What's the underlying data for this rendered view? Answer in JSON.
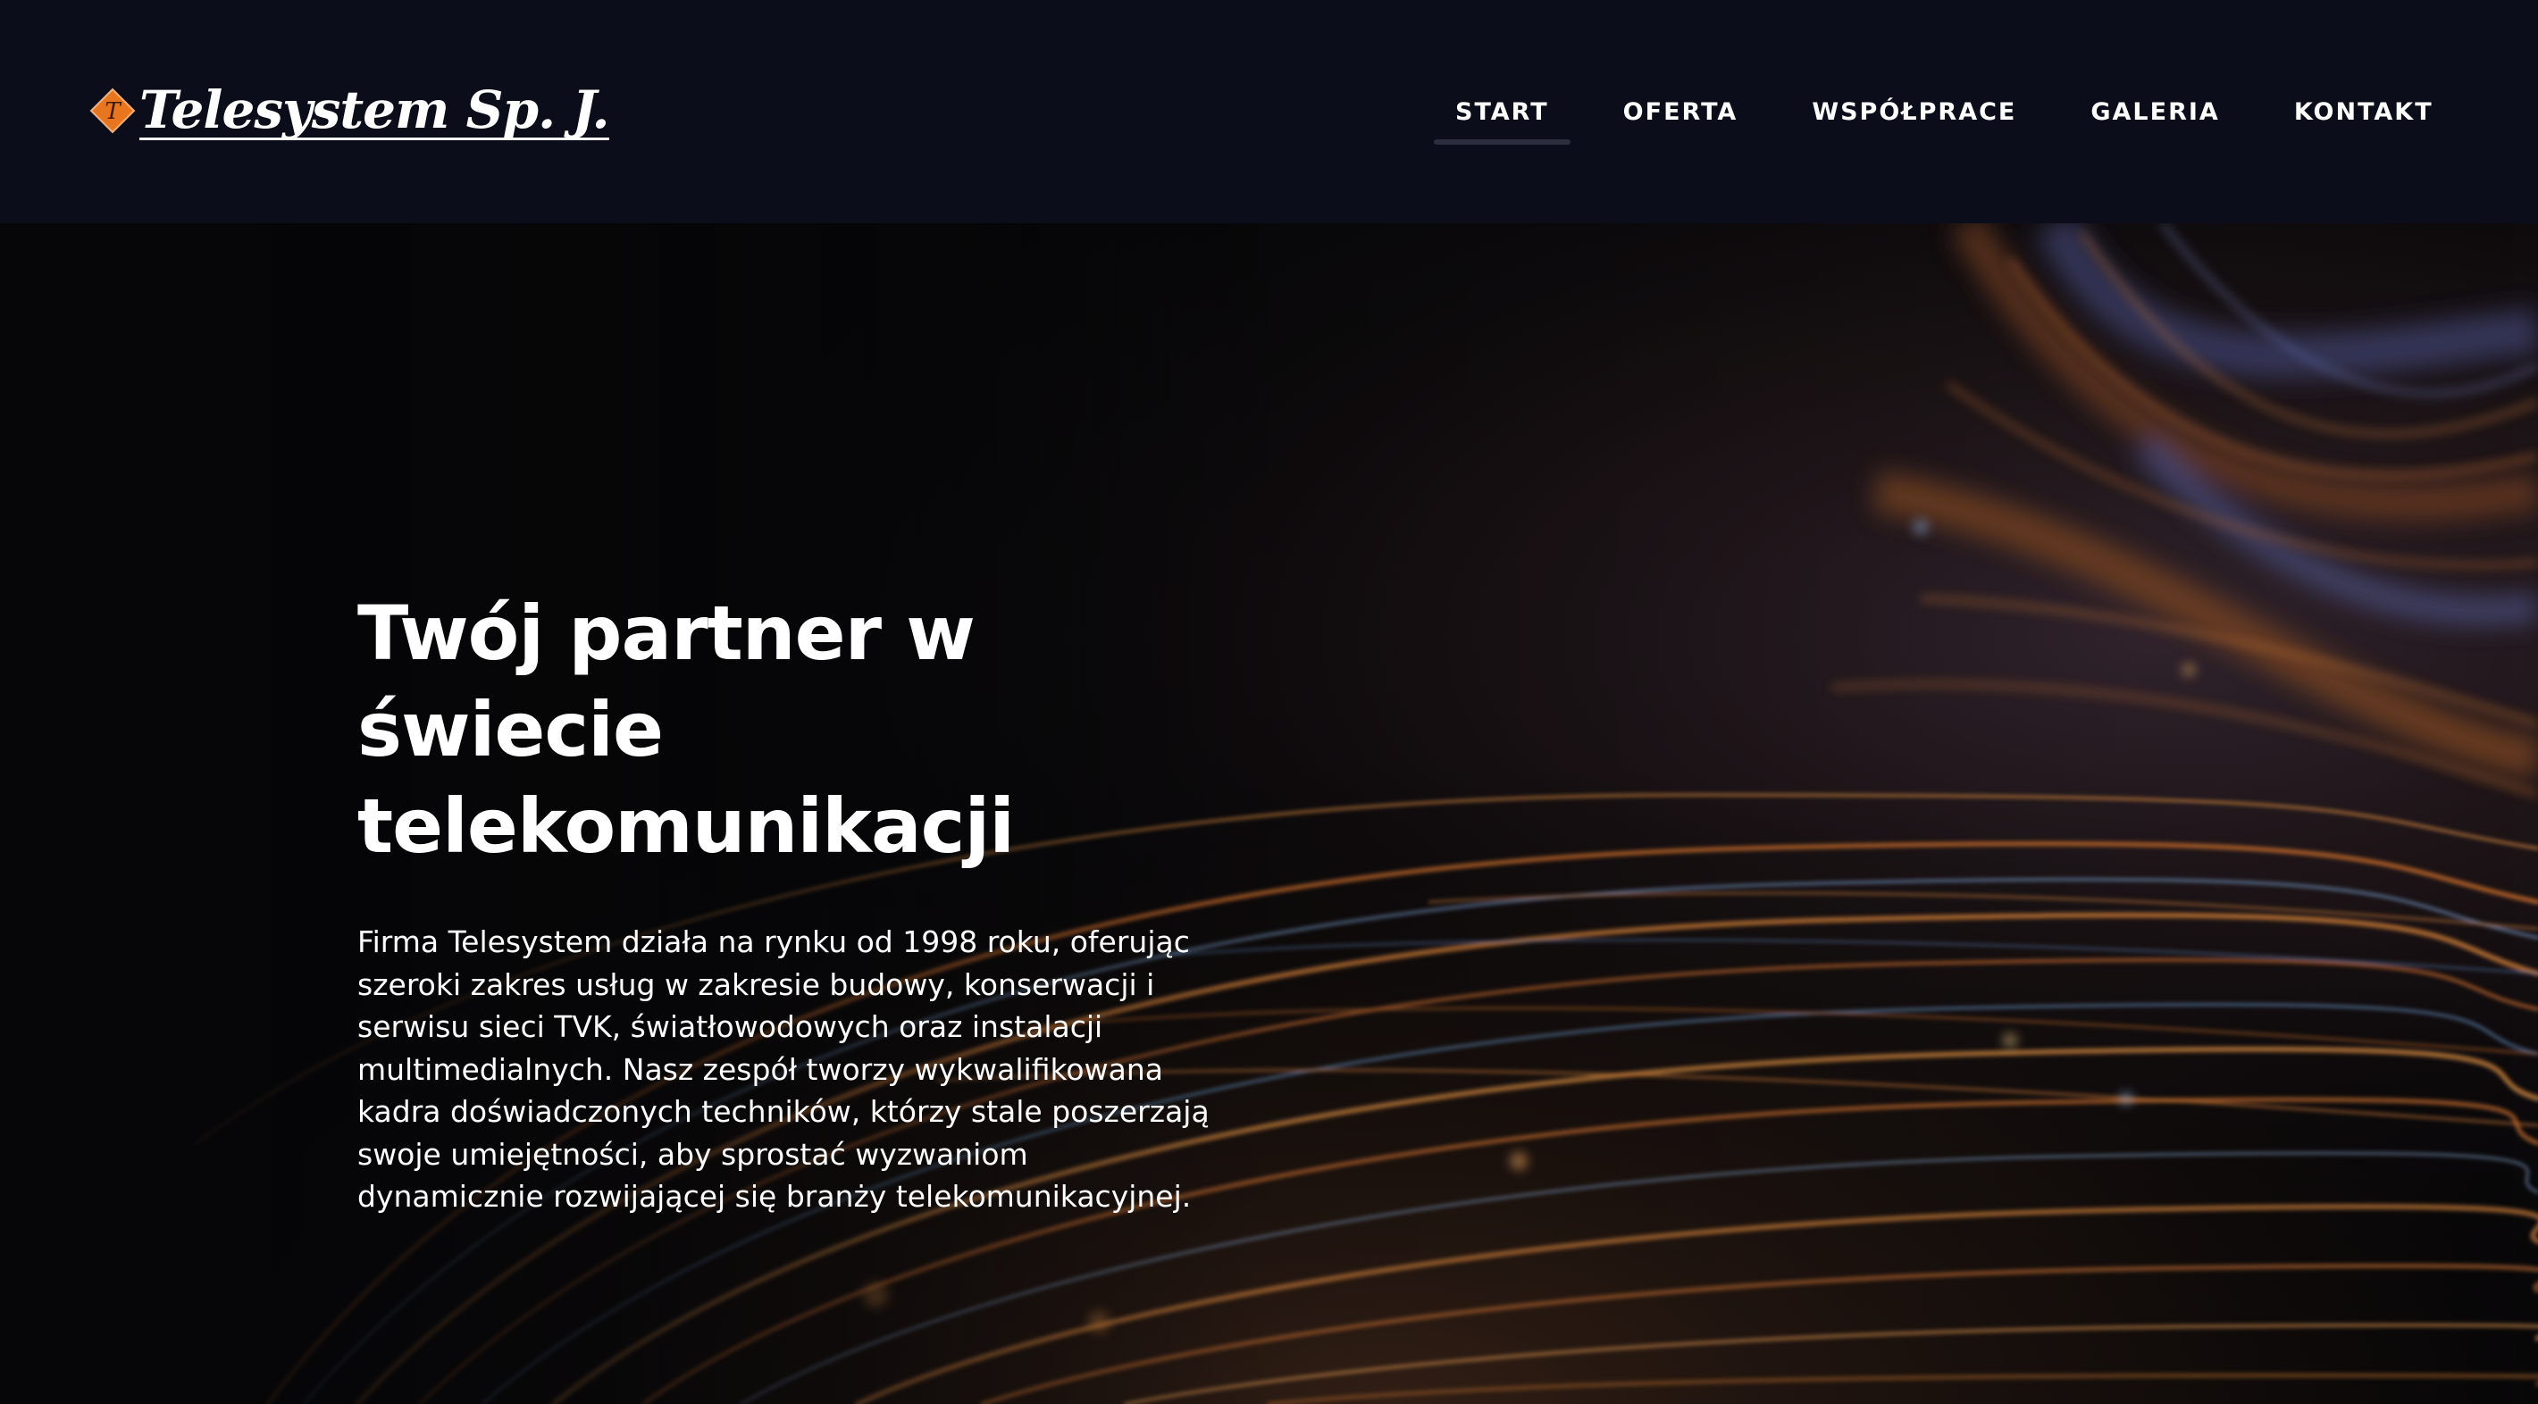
{
  "header": {
    "logo_text": "Telesystem Sp. J.",
    "logo_mark_letter": "T",
    "nav": [
      {
        "label": "START",
        "active": true
      },
      {
        "label": "OFERTA",
        "active": false
      },
      {
        "label": "WSPÓŁPRACE",
        "active": false
      },
      {
        "label": "GALERIA",
        "active": false
      },
      {
        "label": "KONTAKT",
        "active": false
      }
    ]
  },
  "hero": {
    "title_line1": "Twój partner w świecie",
    "title_line2": "telekomunikacji",
    "description": "Firma Telesystem działa na rynku od 1998 roku, oferując szeroki zakres usług w zakresie budowy, konserwacji i serwisu sieci TVK, światłowodowych oraz instalacji multimedialnych. Nasz zespół tworzy wykwalifikowana kadra doświadczonych techników, którzy stale poszerzają swoje umiejętności, aby sprostać wyzwaniom dynamicznie rozwijającej się branży telekomunikacyjnej.",
    "background_image": "fiber-optic-light-streaks"
  },
  "colors": {
    "header_bg": "#0b0d1a",
    "hero_bg": "#060608",
    "text": "#ffffff",
    "logo_accent": "#e8761f",
    "streak_orange": "#d4782e",
    "streak_blue": "#6f9fcf"
  }
}
